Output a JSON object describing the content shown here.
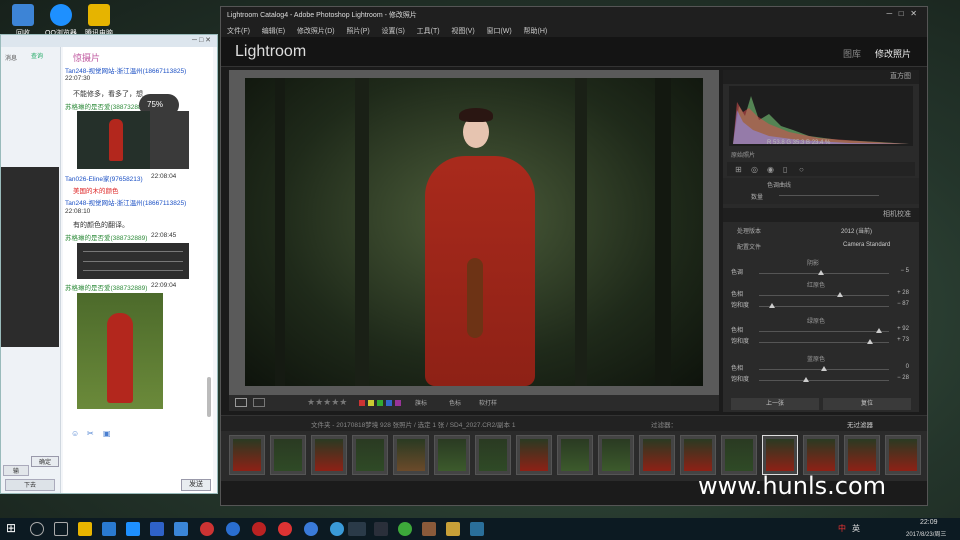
{
  "desktop": {
    "icons": [
      "回收",
      "QQ浏览器",
      "腾讯电脑管家"
    ],
    "watermark": "www.hunls.com"
  },
  "chat": {
    "window_controls": "─ □ ✕",
    "title": "惊摄片",
    "left_items": [
      "消息",
      "联系人"
    ],
    "search_label": "查询",
    "zoom": "75%",
    "messages": [
      {
        "author": "Tan248-视觉网站-浙江温州(18667113825)",
        "time": "22:07:30",
        "text": "不能修多，看多了，想"
      },
      {
        "author": "苏格琳的是否爱(388732889)",
        "time": "",
        "text": ""
      },
      {
        "author": "Tan026-Eline家(97658213)",
        "time": "22:08:04",
        "text": "美国的木的颜色"
      },
      {
        "author": "Tan248-视觉网站-浙江温州(18667113825)",
        "time": "22:08:10",
        "text": "有的颜色的翻译。"
      },
      {
        "author": "苏格琳的是否爱(388732889)",
        "time": "22:08:45",
        "text": ""
      },
      {
        "author": "苏格琳的是否爱(388732889)",
        "time": "22:09:04",
        "text": ""
      }
    ],
    "send_button": "发送",
    "confirm_button": "确定",
    "bottom_left": "输",
    "bottom_combo": "下去"
  },
  "lightroom": {
    "title": "Lightroom Catalog4 - Adobe Photoshop Lightroom - 修改照片",
    "menu": [
      "文件(F)",
      "编辑(E)",
      "修改照片(D)",
      "照片(P)",
      "设置(S)",
      "工具(T)",
      "视图(V)",
      "窗口(W)",
      "帮助(H)"
    ],
    "logo": "Lightroom",
    "modules": [
      "图库",
      "修改照片"
    ],
    "histogram_label": "直方图",
    "histogram_readout": "R 53.8  G 35.3  B 23.4 %",
    "original_label": "原始照片",
    "section_a": "色调曲线",
    "section_a_slider": "数量",
    "section_b": "相机校准",
    "process_label": "处理版本",
    "process_value": "2012 (当前)",
    "profile_label": "配置文件",
    "profile_value": "Camera Standard",
    "groups": [
      {
        "title": "阴影",
        "rows": [
          {
            "label": "色调",
            "value": "− 5",
            "pct": 0.48
          }
        ]
      },
      {
        "title": "红原色",
        "rows": [
          {
            "label": "色相",
            "value": "+ 28",
            "pct": 0.62
          },
          {
            "label": "饱和度",
            "value": "− 87",
            "pct": 0.1
          }
        ]
      },
      {
        "title": "绿原色",
        "rows": [
          {
            "label": "色相",
            "value": "+ 92",
            "pct": 0.92
          },
          {
            "label": "饱和度",
            "value": "+ 73",
            "pct": 0.85
          }
        ]
      },
      {
        "title": "蓝原色",
        "rows": [
          {
            "label": "色相",
            "value": "0",
            "pct": 0.5
          },
          {
            "label": "饱和度",
            "value": "− 28",
            "pct": 0.36
          }
        ]
      }
    ],
    "prev_button": "上一张",
    "reset_button": "复位",
    "toolbar": {
      "flag": "旗标",
      "color": "色标",
      "soft_proof": "软打样"
    },
    "filmbar": {
      "path": "文件夹 - 20170818梦境   928 张照片 / 选定 1 张 / SD4_2027.CR2/副本 1",
      "filter": "过滤器：",
      "filter_value": "无过滤器"
    },
    "thumb_count": 17
  },
  "taskbar": {
    "time": "22:09",
    "date": "2017/8/23/周三",
    "tray": [
      "中",
      "英"
    ]
  },
  "colors": {
    "accent_green": "#2e8b3a",
    "link_blue": "#1a4fc4",
    "lr_bg": "#1b1b1b"
  }
}
